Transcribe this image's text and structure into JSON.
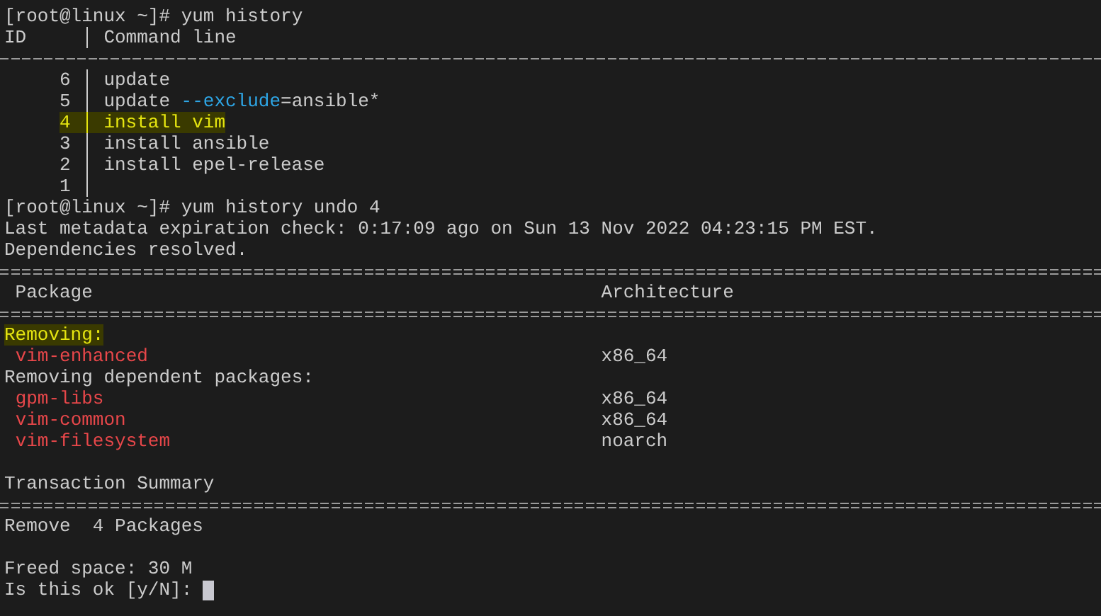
{
  "history_command": "[root@linux ~]# yum history",
  "history": {
    "columns": [
      "ID",
      "Command line"
    ],
    "rows": [
      {
        "id": "6",
        "selected": false,
        "command": [
          {
            "kind": "plain",
            "text": "update"
          }
        ]
      },
      {
        "id": "5",
        "selected": false,
        "command": [
          {
            "kind": "plain",
            "text": "update "
          },
          {
            "kind": "option",
            "text": "--exclude"
          },
          {
            "kind": "plain",
            "text": "=ansible*"
          }
        ]
      },
      {
        "id": "4",
        "selected": true,
        "command": [
          {
            "kind": "plain",
            "text": "install vim"
          }
        ]
      },
      {
        "id": "3",
        "selected": false,
        "command": [
          {
            "kind": "plain",
            "text": "install ansible"
          }
        ]
      },
      {
        "id": "2",
        "selected": false,
        "command": [
          {
            "kind": "plain",
            "text": "install epel-release"
          }
        ]
      },
      {
        "id": "1",
        "selected": false,
        "command": []
      }
    ]
  },
  "undo_command": "[root@linux ~]# yum history undo 4",
  "messages": [
    "Last metadata expiration check: 0:17:09 ago on Sun 13 Nov 2022 04:23:15 PM EST.",
    "Dependencies resolved."
  ],
  "transaction": {
    "columns": [
      "Package",
      "Architecture"
    ],
    "groups": [
      {
        "title": "Removing:",
        "highlighted": true,
        "packages": [
          {
            "name": "vim-enhanced",
            "arch": "x86_64"
          }
        ]
      },
      {
        "title": "Removing dependent packages:",
        "highlighted": false,
        "packages": [
          {
            "name": "gpm-libs",
            "arch": "x86_64"
          },
          {
            "name": "vim-common",
            "arch": "x86_64"
          },
          {
            "name": "vim-filesystem",
            "arch": "noarch"
          }
        ]
      }
    ]
  },
  "summary": {
    "title": "Transaction Summary",
    "lines": [
      "Remove  4 Packages"
    ]
  },
  "freed_space": "Freed space: 30 M",
  "confirm_prompt": "Is this ok [y/N]:"
}
